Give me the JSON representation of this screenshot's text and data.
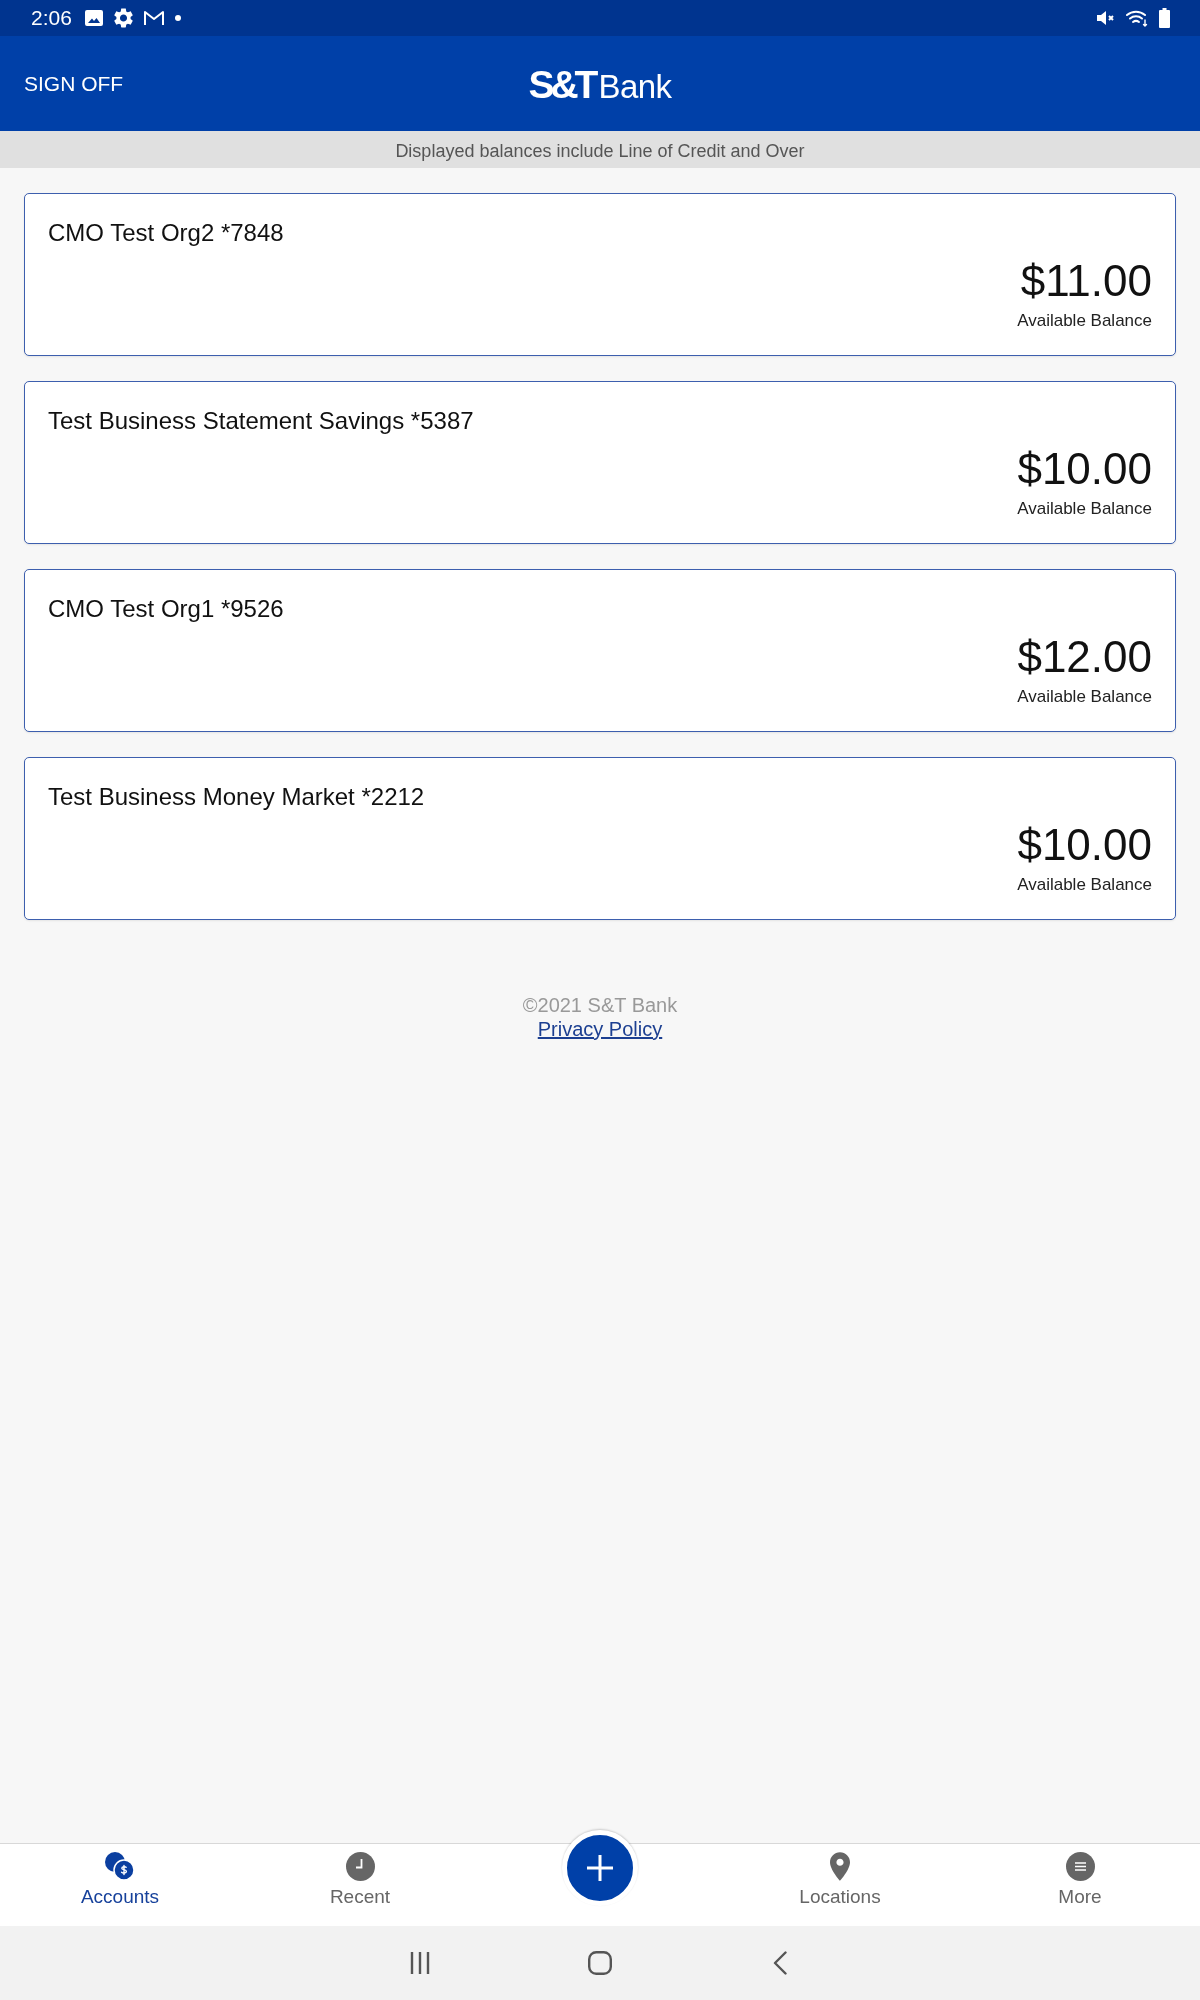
{
  "status_bar": {
    "time": "2:06"
  },
  "header": {
    "sign_off": "SIGN OFF",
    "logo": {
      "mark": "S&T",
      "word": "Bank"
    }
  },
  "notice": "Displayed balances include Line of Credit and Over",
  "accounts": [
    {
      "name": "CMO Test Org2 *7848",
      "balance": "$11.00",
      "balance_label": "Available Balance"
    },
    {
      "name": "Test Business Statement Savings *5387",
      "balance": "$10.00",
      "balance_label": "Available Balance"
    },
    {
      "name": "CMO Test Org1 *9526",
      "balance": "$12.00",
      "balance_label": "Available Balance"
    },
    {
      "name": "Test Business Money Market *2212",
      "balance": "$10.00",
      "balance_label": "Available Balance"
    }
  ],
  "footer": {
    "copyright": "©2021 S&T Bank",
    "link": "Privacy Policy"
  },
  "bottom_nav": [
    {
      "kind": "tab",
      "label": "Accounts",
      "selected": true
    },
    {
      "kind": "tab",
      "label": "Recent",
      "selected": false
    },
    {
      "kind": "action"
    },
    {
      "kind": "tab",
      "label": "Locations",
      "selected": false
    },
    {
      "kind": "tab",
      "label": "More",
      "selected": false
    }
  ]
}
